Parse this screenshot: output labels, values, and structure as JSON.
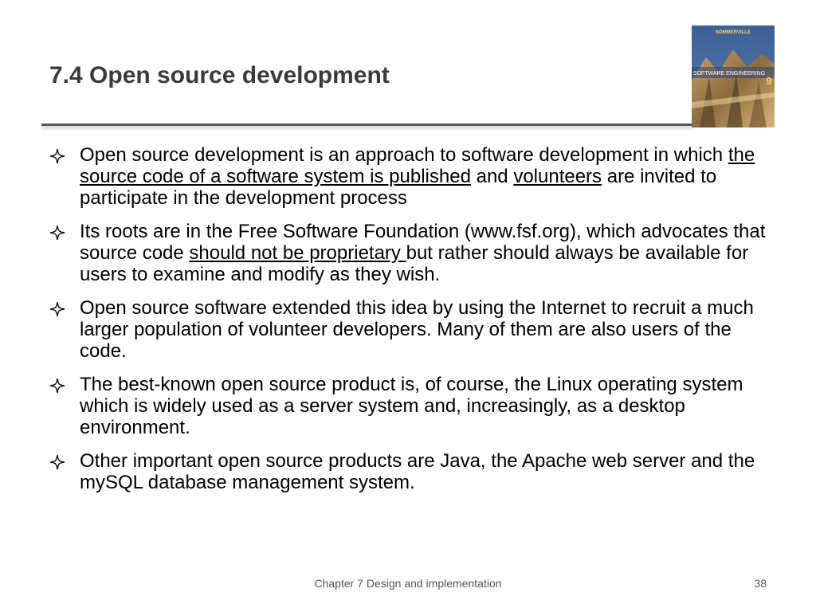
{
  "slide": {
    "title": "7.4 Open source development",
    "book_cover": {
      "author": "SOMMERVILLE",
      "title": "SOFTWARE ENGINEERING",
      "edition": "9"
    }
  },
  "bullets": [
    {
      "parts": [
        {
          "text": "Open source development is an approach to software development in which ",
          "underline": false
        },
        {
          "text": "the source code of a software system is published",
          "underline": true
        },
        {
          "text": " and ",
          "underline": false
        },
        {
          "text": "volunteers",
          "underline": true
        },
        {
          "text": " are invited to participate in the development process",
          "underline": false
        }
      ]
    },
    {
      "parts": [
        {
          "text": "Its roots are in the Free Software Foundation (www.fsf.org), which advocates that source code ",
          "underline": false
        },
        {
          "text": "should not be proprietary ",
          "underline": true
        },
        {
          "text": "but rather should always be available for users to examine and modify as they wish.",
          "underline": false
        }
      ]
    },
    {
      "parts": [
        {
          "text": "Open source software extended this idea by using the Internet to recruit a much larger population of volunteer developers. Many of them are also users of the code.",
          "underline": false
        }
      ]
    },
    {
      "parts": [
        {
          "text": "The best-known open source product is, of course, the Linux operating system which is widely used as a server system and, increasingly, as a desktop environment.",
          "underline": false
        }
      ]
    },
    {
      "parts": [
        {
          "text": "Other important open source products are Java, the Apache web server and the mySQL database management system.",
          "underline": false
        }
      ]
    }
  ],
  "bullet_icon": "four-point-star-icon",
  "footer": {
    "text": "Chapter 7 Design and implementation",
    "page_number": "38"
  }
}
